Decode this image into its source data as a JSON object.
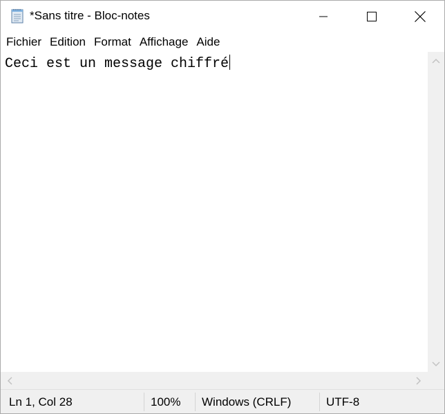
{
  "window": {
    "title": "*Sans titre - Bloc-notes",
    "icon": "notepad-icon"
  },
  "menu": {
    "items": [
      {
        "label": "Fichier"
      },
      {
        "label": "Edition"
      },
      {
        "label": "Format"
      },
      {
        "label": "Affichage"
      },
      {
        "label": "Aide"
      }
    ]
  },
  "editor": {
    "text": "Ceci est un message chiffré"
  },
  "status": {
    "position": "Ln 1, Col 28",
    "zoom": "100%",
    "line_ending": "Windows (CRLF)",
    "encoding": "UTF-8"
  },
  "colors": {
    "chrome": "#f0f0f0",
    "window_bg": "#ffffff",
    "border": "#aaaaaa"
  }
}
